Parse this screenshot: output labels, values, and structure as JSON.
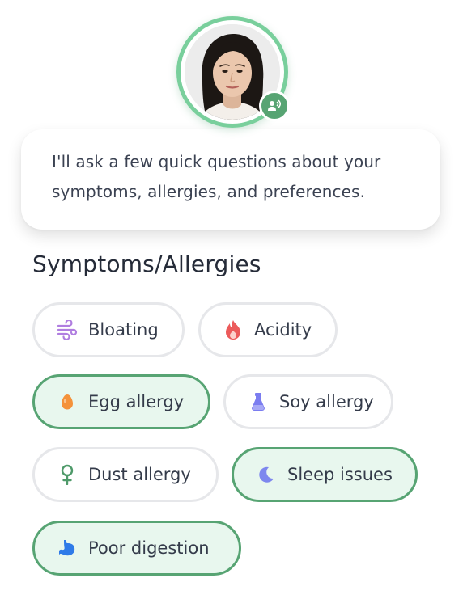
{
  "assistant": {
    "avatar_alt": "Assistant avatar",
    "voice_icon": "voice-speaking-icon"
  },
  "intro": {
    "message": "I'll ask a few quick questions about your symptoms, allergies, and preferences."
  },
  "section": {
    "title": "Symptoms/Allergies"
  },
  "colors": {
    "accent": "#57a473",
    "ring": "#79cf9c",
    "selected_bg": "#e8f7ee",
    "chip_border": "#e6e7ea"
  },
  "chips": [
    {
      "label": "Bloating",
      "icon": "wind-icon",
      "selected": false
    },
    {
      "label": "Acidity",
      "icon": "flame-icon",
      "selected": false
    },
    {
      "label": "Egg allergy",
      "icon": "egg-icon",
      "selected": true
    },
    {
      "label": "Soy allergy",
      "icon": "bottle-icon",
      "selected": false
    },
    {
      "label": "Dust allergy",
      "icon": "female-symbol-icon",
      "selected": false
    },
    {
      "label": "Sleep issues",
      "icon": "moon-icon",
      "selected": true
    },
    {
      "label": "Poor digestion",
      "icon": "stomach-icon",
      "selected": true
    }
  ]
}
